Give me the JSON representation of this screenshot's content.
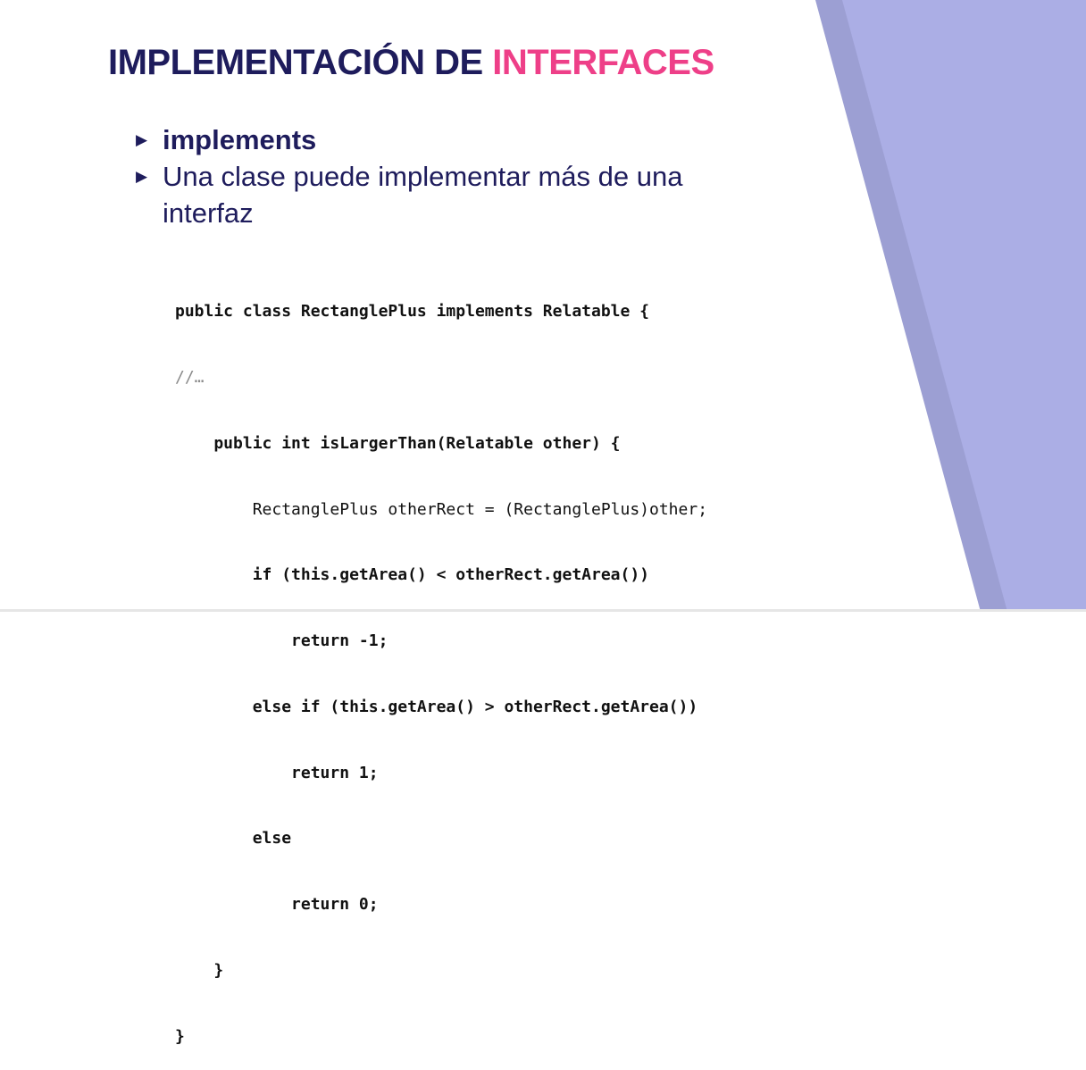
{
  "title": {
    "main": "IMPLEMENTACIÓN DE",
    "accent": "INTERFACES"
  },
  "bullets": [
    {
      "text": "implements"
    },
    {
      "text": "Una clase puede implementar más de una interfaz"
    }
  ],
  "code": {
    "lines": [
      "public class RectanglePlus implements Relatable {",
      "//…",
      "    public int isLargerThan(Relatable other) {",
      "        RectanglePlus otherRect = (RectanglePlus)other;",
      "        if (this.getArea() < otherRect.getArea())",
      "            return -1;",
      "        else if (this.getArea() > otherRect.getArea())",
      "            return 1;",
      "        else",
      "            return 0;",
      "    }",
      "}"
    ]
  },
  "colors": {
    "title": "#1e1c5c",
    "accent": "#ee3f88",
    "panel_dark": "#9c9fd3",
    "panel_light": "#abaee5"
  }
}
